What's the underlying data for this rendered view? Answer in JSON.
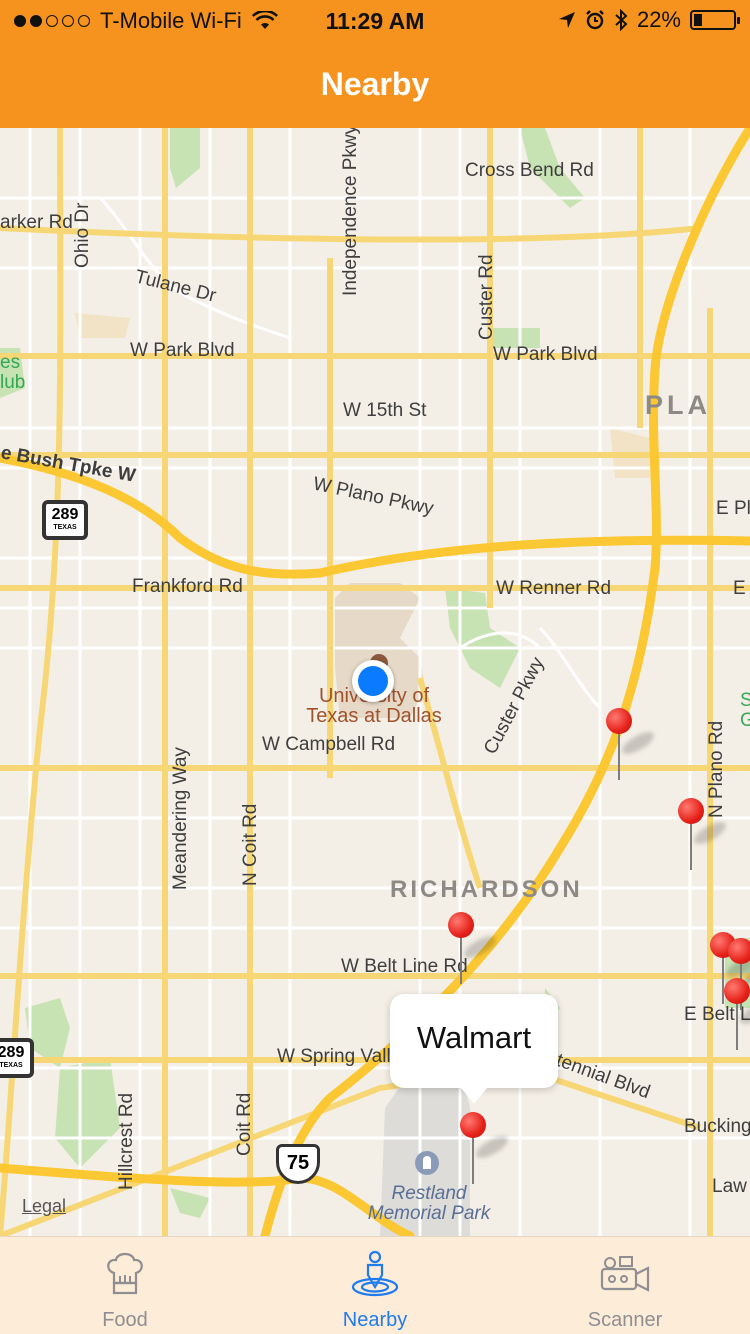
{
  "status_bar": {
    "carrier": "T-Mobile Wi-Fi",
    "time": "11:29 AM",
    "battery": "22%",
    "battery_level": 0.22,
    "icons": [
      "signal-dots-icon",
      "wifi-icon",
      "location-arrow-icon",
      "alarm-icon",
      "bluetooth-icon",
      "battery-icon"
    ]
  },
  "nav": {
    "title": "Nearby"
  },
  "map": {
    "labels": {
      "cross_bend": "Cross Bend Rd",
      "parker": "arker Rd",
      "ohio": "Ohio Dr",
      "tulane": "Tulane Dr",
      "independence": "Independence Pkwy",
      "custer_n": "Custer Rd",
      "w_park_1": "W Park Blvd",
      "w_park_2": "W Park Blvd",
      "w_15th": "W 15th St",
      "pla": "PLA",
      "bush": "e Bush Tpke W",
      "w_plano": "W Plano Pkwy",
      "e_pl": "E Pl",
      "frankford": "Frankford Rd",
      "w_renner": "W Renner Rd",
      "e_short": "E",
      "utd": "University of Texas at Dallas",
      "custer_pkwy": "Custer Pkwy",
      "w_campbell": "W Campbell Rd",
      "n_plano": "N Plano Rd",
      "meandering": "Meandering Way",
      "n_coit": "N Coit Rd",
      "richardson": "RICHARDSON",
      "w_belt": "W Belt Line Rd",
      "e_belt": "E Belt L",
      "w_spring": "W Spring Valley Rd",
      "centennial": "Centennial Blvd",
      "bucking": "Bucking",
      "hillcrest": "Hillcrest Rd",
      "coit": "Coit Rd",
      "law": "Law",
      "restland": "Restland Memorial Park",
      "green_es": "es",
      "green_lub": "lub",
      "green_s": "S",
      "green_g": "G"
    },
    "shields": {
      "tx289_a": "289",
      "tx289_b": "289",
      "texas": "TEXAS",
      "us75": "75"
    },
    "callout": "Walmart",
    "legal": "Legal",
    "pins": 7
  },
  "tabs": [
    {
      "label": "Food",
      "icon": "chef-hat-icon",
      "active": false
    },
    {
      "label": "Nearby",
      "icon": "location-person-icon",
      "active": true
    },
    {
      "label": "Scanner",
      "icon": "video-camera-icon",
      "active": false
    }
  ],
  "colors": {
    "accent": "#f6921e",
    "tab_active": "#1e7bf0",
    "tab_inactive": "#8e8e93",
    "pin": "#e52119",
    "user_location": "#0a7bff"
  }
}
